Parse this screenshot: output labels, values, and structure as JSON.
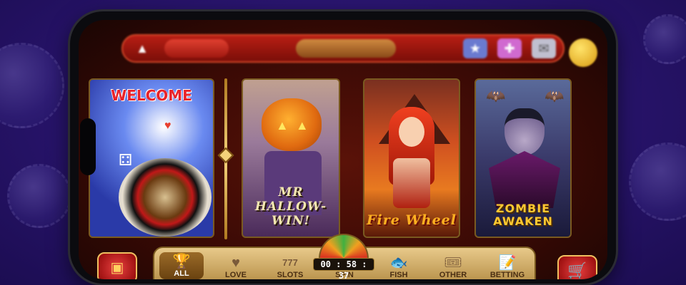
{
  "top_bar": {
    "home_icon": "home-icon",
    "center_logo": "blurred-logo",
    "icons": [
      "trophy-icon",
      "gift-icon",
      "mail-icon"
    ]
  },
  "games": [
    {
      "title": "WELCOME",
      "theme": "roulette",
      "colors": {
        "bg": "#3050c8",
        "title": "#e8222a"
      }
    },
    {
      "title": "MR HALLOW-WIN!",
      "theme": "pumpkin",
      "colors": {
        "bg": "#6a4a8a",
        "title": "#f2e6b0"
      }
    },
    {
      "title": "Fire Wheel",
      "theme": "fire",
      "colors": {
        "bg": "#b03a18",
        "title": "#ffb020"
      }
    },
    {
      "title": "ZOMBIE AWAKEN",
      "theme": "vampire",
      "colors": {
        "bg": "#3a4a7a",
        "title": "#ffc830"
      }
    }
  ],
  "timer": "00 : 58 : 37",
  "nav": [
    {
      "label": "ALL",
      "icon": "trophy-icon",
      "glyph": "🏆",
      "active": true
    },
    {
      "label": "LOVE",
      "icon": "heart-icon",
      "glyph": "♥",
      "active": false
    },
    {
      "label": "SLOTS",
      "icon": "slots-icon",
      "glyph": "777",
      "active": false
    },
    {
      "label": "SPIN",
      "icon": "spin-wheel-icon",
      "glyph": "",
      "active": false
    },
    {
      "label": "FISH",
      "icon": "fish-icon",
      "glyph": "🐟",
      "active": false
    },
    {
      "label": "OTHER",
      "icon": "ticket-icon",
      "glyph": "🎟",
      "active": false
    },
    {
      "label": "BETTING",
      "icon": "betting-slip-icon",
      "glyph": "📝",
      "active": false
    }
  ],
  "colors": {
    "accent": "#e8c98a",
    "frame": "#7a5a20"
  }
}
